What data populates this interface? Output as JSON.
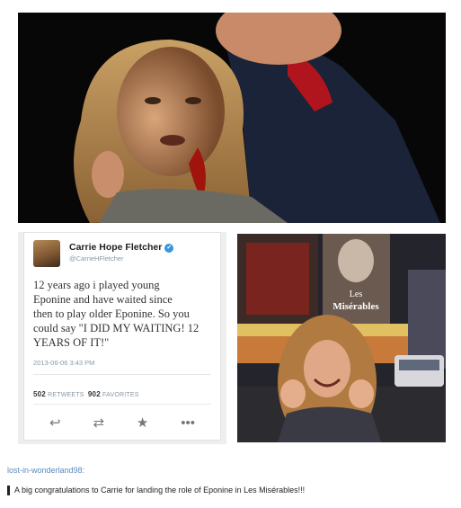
{
  "tweet": {
    "name": "Carrie Hope Fletcher",
    "verified_icon": "verified-check-icon",
    "handle": "@CarrieHFletcher",
    "text": "12 years ago i played young\nEponine and have waited since\nthen to play older Eponine. So you\ncould say \"I DID MY WAITING! 12\nYEARS OF IT!\"",
    "timestamp": "2013-06-06 3:43 PM",
    "retweets_count": "502",
    "retweets_label": "RETWEETS",
    "favorites_count": "902",
    "favorites_label": "FAVORITES",
    "actions": [
      "reply-icon",
      "retweet-icon",
      "favorite-icon",
      "more-icon"
    ]
  },
  "street_photo": {
    "sign_line1": "Les",
    "sign_line2": "Misérables"
  },
  "caption": {
    "username": "lost-in-wonderland98:",
    "quote": "A big congratulations to Carrie for landing the role of Eponine in Les Misérables!!!"
  },
  "colors": {
    "link": "#5a8ab8",
    "verified": "#3b94d9",
    "blood": "#a0140c"
  }
}
